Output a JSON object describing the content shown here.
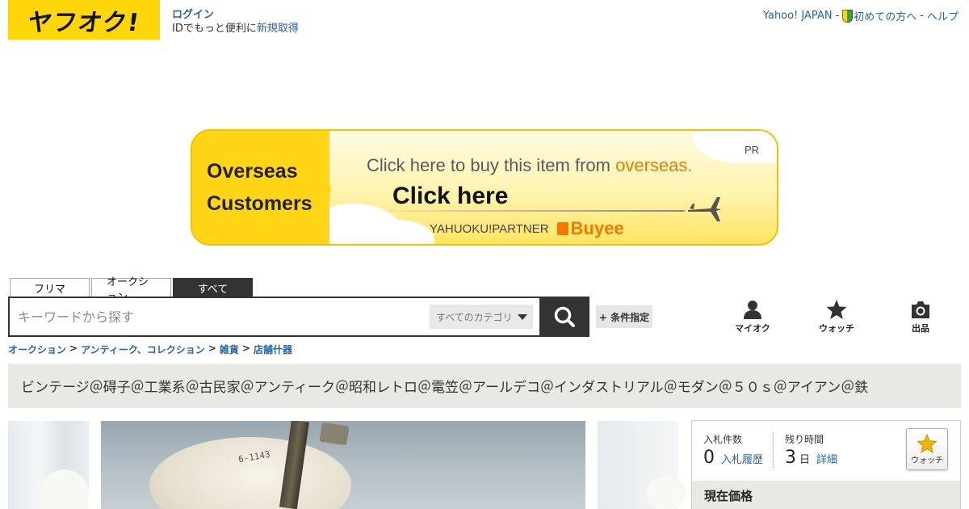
{
  "header": {
    "logo": "ヤフオク!",
    "login_label": "ログイン",
    "login_sub_prefix": "IDでもっと便利に",
    "register_label": "新規取得",
    "yahoo_japan": "Yahoo! JAPAN",
    "separator": "-",
    "beginner_label": "初めての方へ",
    "help_label": "ヘルプ"
  },
  "banner": {
    "left_line1": "Overseas",
    "left_line2": "Customers",
    "pr": "PR",
    "line1_prefix": "Click here to buy this item from ",
    "line1_highlight": "overseas.",
    "line2": "Click here",
    "partner": "YAHUOKU!PARTNER",
    "buyee": "Buyee"
  },
  "search": {
    "tabs": [
      "フリマ",
      "オークション",
      "すべて"
    ],
    "active_tab": "すべて",
    "placeholder": "キーワードから探す",
    "category": "すべてのカテゴリ",
    "condition_button": "+ 条件指定"
  },
  "quick_nav": {
    "myauc": "マイオク",
    "watch": "ウォッチ",
    "sell": "出品"
  },
  "breadcrumb": {
    "items": [
      "オークション",
      "アンティーク、コレクション",
      "雑貨",
      "店舗什器"
    ],
    "separator": ">"
  },
  "item": {
    "title": "ビンテージ＠碍子＠工業系＠古民家＠アンティーク＠昭和レトロ＠電笠＠アールデコ＠インダストリアル＠モダン＠５０ｓ＠アイアン＠鉄",
    "image_mark": "6-1143"
  },
  "bid": {
    "bids_label": "入札件数",
    "bids_value": "0",
    "bids_link": "入札履歴",
    "time_label": "残り時間",
    "time_value": "3",
    "time_unit": "日",
    "time_link": "詳細",
    "watch_label": "ウォッチ",
    "price_header": "現在価格"
  },
  "colors": {
    "brand_yellow": "#ffd60a",
    "link_blue": "#2563a8",
    "dark": "#333333",
    "accent_orange": "#f07a00"
  }
}
